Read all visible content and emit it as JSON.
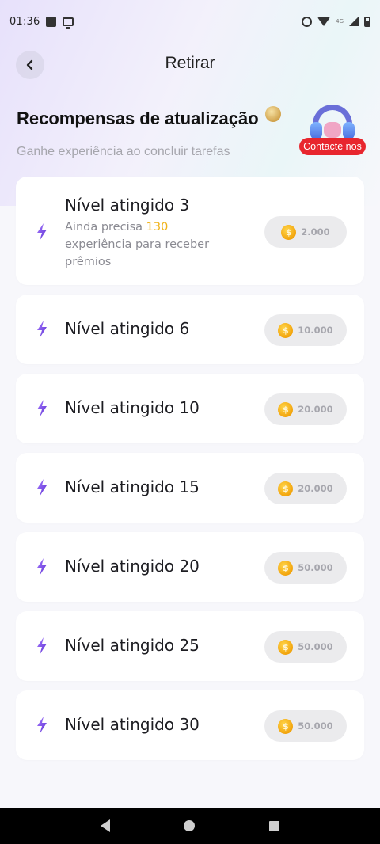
{
  "status_bar": {
    "time": "01:36",
    "network_label": "4G"
  },
  "header": {
    "title": "Retirar"
  },
  "section": {
    "title": "Recompensas de atualização",
    "subtitle": "Ganhe experiência ao concluir tarefas"
  },
  "support": {
    "badge_label": "Contacte nos"
  },
  "colors": {
    "accent_purple": "#7b46e0",
    "highlight_yellow": "#f0b31a",
    "coin_gold": "#f2a40c",
    "badge_red": "#e8262e"
  },
  "rewards": [
    {
      "title": "Nível atingido 3",
      "desc_prefix": "Ainda precisa ",
      "desc_highlight": "130",
      "desc_suffix": " experiência para receber prêmios",
      "amount": "2.000",
      "coin_symbol": "$"
    },
    {
      "title": "Nível atingido 6",
      "amount": "10.000",
      "coin_symbol": "$"
    },
    {
      "title": "Nível atingido 10",
      "amount": "20.000",
      "coin_symbol": "$"
    },
    {
      "title": "Nível atingido 15",
      "amount": "20.000",
      "coin_symbol": "$"
    },
    {
      "title": "Nível atingido 20",
      "amount": "50.000",
      "coin_symbol": "$"
    },
    {
      "title": "Nível atingido 25",
      "amount": "50.000",
      "coin_symbol": "$"
    },
    {
      "title": "Nível atingido 30",
      "amount": "50.000",
      "coin_symbol": "$"
    }
  ]
}
